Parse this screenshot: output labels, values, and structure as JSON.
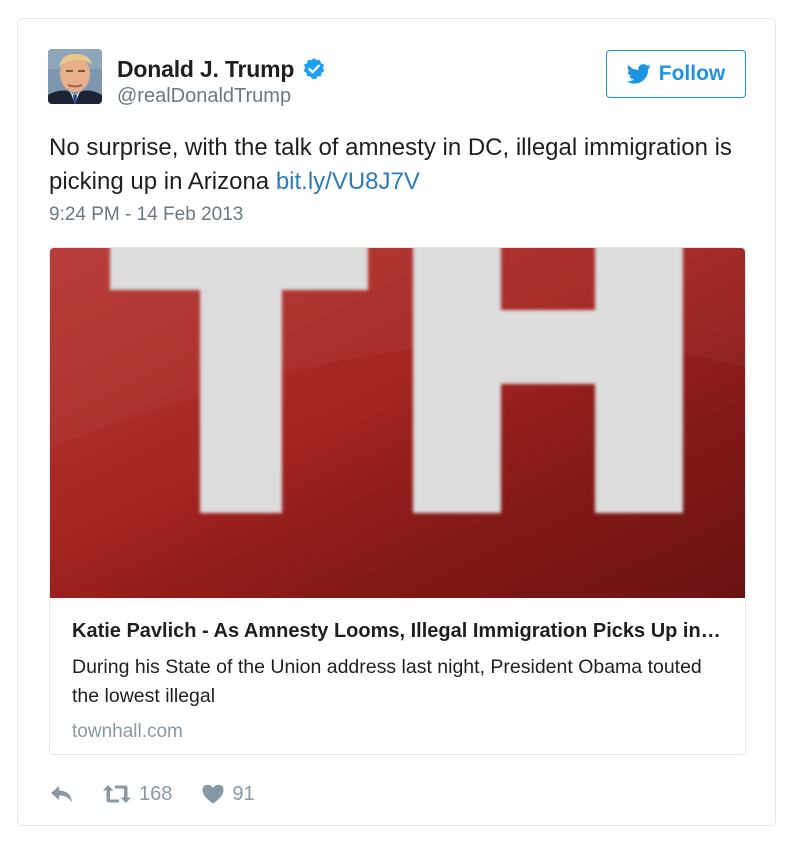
{
  "user": {
    "display_name": "Donald J. Trump",
    "handle": "@realDonaldTrump",
    "verified_icon": "verified-badge-icon"
  },
  "follow_button": {
    "label": "Follow",
    "icon": "twitter-bird-icon"
  },
  "tweet": {
    "text": "No surprise, with the talk of amnesty in DC, illegal immigration is picking up in Arizona ",
    "link_text": "bit.ly/VU8J7V",
    "timestamp": "9:24 PM - 14 Feb 2013"
  },
  "card": {
    "image_lettering": "TH",
    "title": "Katie Pavlich - As Amnesty Looms, Illegal Immigration Picks Up in Arizona",
    "description": "During his State of the Union address last night, President Obama touted the lowest illegal",
    "domain": "townhall.com"
  },
  "actions": {
    "reply_icon": "reply-icon",
    "retweet_icon": "retweet-icon",
    "retweet_count": "168",
    "like_icon": "heart-icon",
    "like_count": "91"
  },
  "colors": {
    "link": "#2b7bb9",
    "follow": "#1b95e0",
    "muted": "#697882",
    "card_red": "#a32320"
  }
}
